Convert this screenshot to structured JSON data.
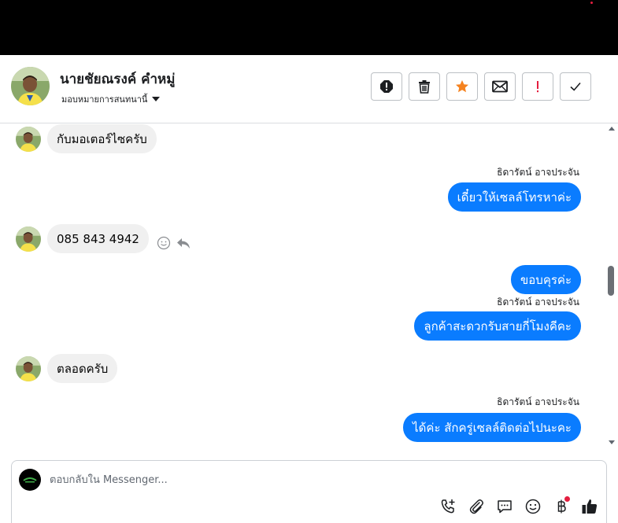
{
  "contact": {
    "name": "นายชัยณรงค์ คำหมู่",
    "assign_label": "มอบหมายการสนทนานี้"
  },
  "header_actions": [
    {
      "icon": "alert-circle-icon",
      "color": "#1c1e21"
    },
    {
      "icon": "trash-icon",
      "color": "#1c1e21"
    },
    {
      "icon": "star-icon",
      "color": "#f5821f"
    },
    {
      "icon": "envelope-icon",
      "color": "#1c1e21"
    },
    {
      "icon": "exclamation-icon",
      "color": "#e41e3f"
    },
    {
      "icon": "checkmark-icon",
      "color": "#1c1e21"
    }
  ],
  "messages": [
    {
      "direction": "in",
      "text": "กับมอเตอร์ไซครับ"
    },
    {
      "direction": "out",
      "sender": "ธิดารัตน์ อาจประจัน",
      "text": "เดี๋ยวให้เซลล์โทรหาค่ะ"
    },
    {
      "direction": "in",
      "text": "085 843 4942"
    },
    {
      "direction": "out",
      "text": "ขอบคุรค่ะ"
    },
    {
      "direction": "out",
      "sender": "ธิดารัตน์ อาจประจัน",
      "text": "ลูกค้าสะดวกรับสายกี่โมงคีคะ"
    },
    {
      "direction": "in",
      "text": "ตลอดครับ"
    },
    {
      "direction": "out",
      "sender": "ธิดารัตน์ อาจประจัน",
      "text": "ได้ค่ะ สักครู่เซลล์ติดต่อไปนะคะ"
    }
  ],
  "composer": {
    "placeholder": "ตอบกลับใน Messenger..."
  },
  "colors": {
    "outgoing_bubble": "#0a7cff",
    "incoming_bubble": "#f0f0f0",
    "top_bar": "#000000"
  }
}
